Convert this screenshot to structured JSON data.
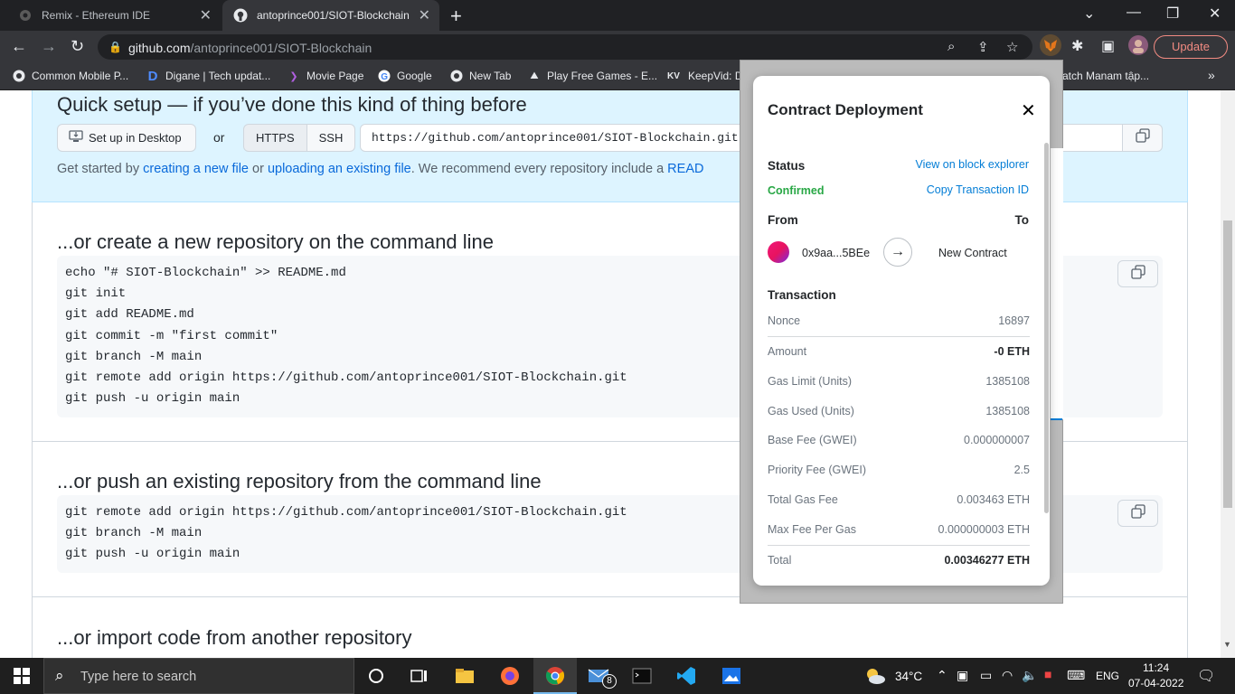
{
  "browser": {
    "tabs": [
      {
        "title": "Remix - Ethereum IDE"
      },
      {
        "title": "antoprince001/SIOT-Blockchain"
      }
    ],
    "url_domain": "github.com",
    "url_path": "/antoprince001/SIOT-Blockchain",
    "update_label": "Update",
    "bookmarks": [
      "Common Mobile P...",
      "Digane | Tech updat...",
      "Movie Page",
      "Google",
      "New Tab",
      "Play Free Games - E...",
      "KeepVid: D",
      "atch Manam tập..."
    ],
    "bookmark_icons": {
      "kv": "KV"
    }
  },
  "page": {
    "setup_title": "Quick setup — if you’ve done this kind of thing before",
    "desktop_button": "Set up in Desktop",
    "or": "or",
    "https": "HTTPS",
    "ssh": "SSH",
    "clone_url": "https://github.com/antoprince001/SIOT-Blockchain.git",
    "setup_text": {
      "prefix": "Get started by ",
      "link1": "creating a new file",
      "mid": " or ",
      "link2": "uploading an existing file",
      "suffix": ". We recommend every repository include a ",
      "link3": "READ"
    },
    "sections": [
      {
        "title": "...or create a new repository on the command line",
        "lines": [
          "echo \"# SIOT-Blockchain\" >> README.md",
          "git init",
          "git add README.md",
          "git commit -m \"first commit\"",
          "git branch -M main",
          "git remote add origin https://github.com/antoprince001/SIOT-Blockchain.git",
          "git push -u origin main"
        ]
      },
      {
        "title": "...or push an existing repository from the command line",
        "lines": [
          "git remote add origin https://github.com/antoprince001/SIOT-Blockchain.git",
          "git branch -M main",
          "git push -u origin main"
        ]
      },
      {
        "title": "...or import code from another repository"
      }
    ]
  },
  "metamask": {
    "title": "Contract Deployment",
    "status_label": "Status",
    "status_value": "Confirmed",
    "view_explorer": "View on block explorer",
    "copy_tx": "Copy Transaction ID",
    "from_label": "From",
    "to_label": "To",
    "from_address": "0x9aa...5BEe",
    "to_value": "New Contract",
    "transaction_label": "Transaction",
    "rows": [
      {
        "label": "Nonce",
        "value": "16897"
      },
      {
        "label": "Amount",
        "value": "-0 ETH"
      },
      {
        "label": "Gas Limit (Units)",
        "value": "1385108"
      },
      {
        "label": "Gas Used (Units)",
        "value": "1385108"
      },
      {
        "label": "Base Fee (GWEI)",
        "value": "0.000000007"
      },
      {
        "label": "Priority Fee (GWEI)",
        "value": "2.5"
      },
      {
        "label": "Total Gas Fee",
        "value": "0.003463 ETH"
      },
      {
        "label": "Max Fee Per Gas",
        "value": "0.000000003 ETH"
      },
      {
        "label": "Total",
        "value": "0.00346277 ETH"
      }
    ],
    "colors": {
      "confirmed": "#28a745",
      "link": "#037dd6"
    }
  },
  "taskbar": {
    "search_placeholder": "Type here to search",
    "temperature": "34°C",
    "language": "ENG",
    "time": "11:24",
    "date": "07-04-2022",
    "mail_badge": "8"
  }
}
